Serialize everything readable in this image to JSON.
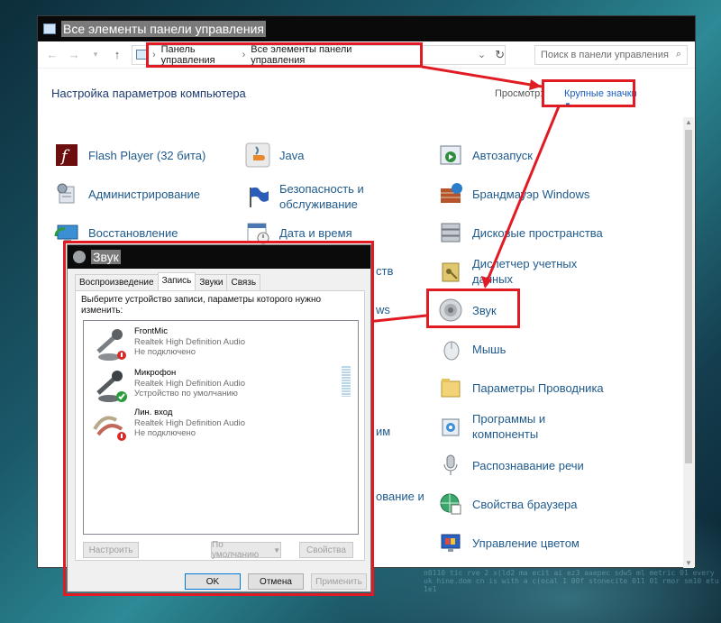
{
  "window": {
    "title": "Все элементы панели управления",
    "breadcrumb": [
      "Панель управления",
      "Все элементы панели управления"
    ],
    "search_placeholder": "Поиск в панели управления",
    "page_title": "Настройка параметров компьютера",
    "view_label": "Просмотр:",
    "view_value": "Крупные значки"
  },
  "items": {
    "col1": [
      "Flash Player (32 бита)",
      "Администрирование",
      "Восстановление"
    ],
    "col2": [
      "Java",
      "Безопасность и обслуживание",
      "Дата и время"
    ],
    "col3": [
      "Автозапуск",
      "Брандмауэр Windows",
      "Дисковые пространства",
      "Диспетчер учетных данных",
      "Звук",
      "Мышь",
      "Параметры Проводника",
      "Программы и компоненты",
      "Распознавание речи",
      "Свойства браузера",
      "Управление цветом"
    ],
    "partial": [
      "ств",
      "ws",
      "им",
      "ование и"
    ]
  },
  "dialog": {
    "title": "Звук",
    "tabs": [
      "Воспроизведение",
      "Запись",
      "Звуки",
      "Связь"
    ],
    "active_tab": "Запись",
    "instruction": "Выберите устройство записи, параметры которого нужно изменить:",
    "devices": [
      {
        "name": "FrontMic",
        "driver": "Realtek High Definition Audio",
        "status": "Не подключено"
      },
      {
        "name": "Микрофон",
        "driver": "Realtek High Definition Audio",
        "status": "Устройство по умолчанию"
      },
      {
        "name": "Лин. вход",
        "driver": "Realtek High Definition Audio",
        "status": "Не подключено"
      }
    ],
    "btn_configure": "Настроить",
    "btn_default": "По умолчанию",
    "btn_properties": "Свойства",
    "btn_ok": "OK",
    "btn_cancel": "Отмена",
    "btn_apply": "Применить"
  },
  "colors": {
    "highlight": "#e01b24",
    "link": "#1f5a8c",
    "accent": "#1a5dbd"
  }
}
